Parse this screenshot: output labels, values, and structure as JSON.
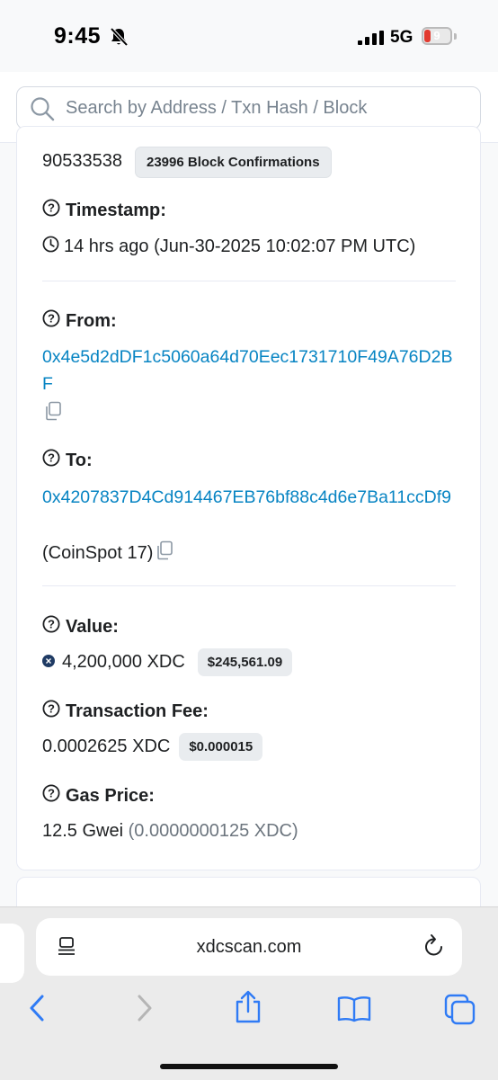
{
  "status_bar": {
    "time": "9:45",
    "network": "5G",
    "battery": "9"
  },
  "search": {
    "placeholder": "Search by Address / Txn Hash / Block"
  },
  "block": {
    "number": "90533538",
    "confirmations": "23996 Block Confirmations"
  },
  "timestamp": {
    "label": "Timestamp:",
    "value": "14 hrs ago (Jun-30-2025 10:02:07 PM UTC)"
  },
  "from": {
    "label": "From:",
    "address": "0x4e5d2dDF1c5060a64d70Eec1731710F49A76D2BF"
  },
  "to": {
    "label": "To:",
    "address": "0x4207837D4Cd914467EB76bf88c4d6e7Ba11ccDf9",
    "name_tag": "(CoinSpot 17)"
  },
  "value": {
    "label": "Value:",
    "amount": "4,200,000 XDC",
    "usd": "$245,561.09"
  },
  "fee": {
    "label": "Transaction Fee:",
    "amount": "0.0002625 XDC",
    "usd": "$0.000015"
  },
  "gas": {
    "label": "Gas Price:",
    "gwei": "12.5 Gwei",
    "xdc": "(0.0000000125 XDC)"
  },
  "browser": {
    "url": "xdcscan.com"
  },
  "colors": {
    "link": "#0784c3",
    "text": "#1e2022",
    "muted": "#6c757e",
    "ios_blue": "#2f7bf5"
  }
}
